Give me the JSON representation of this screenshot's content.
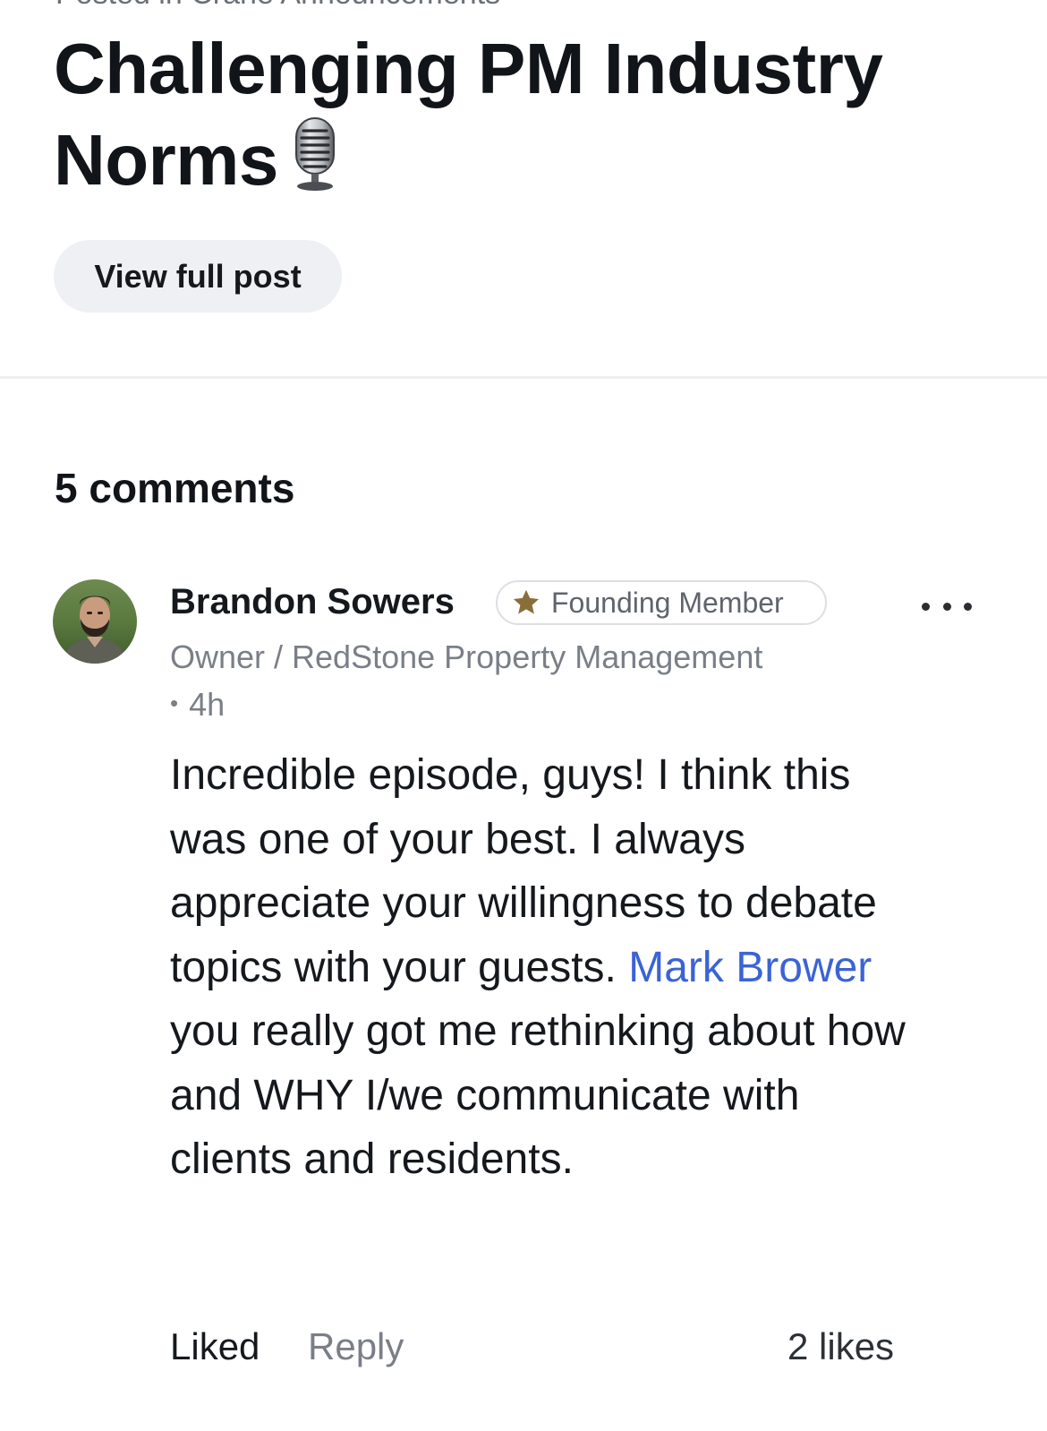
{
  "post": {
    "posted_in": "Posted in Crane Announcements",
    "title": "Challenging PM Industry Norms",
    "title_icon": "microphone-icon",
    "view_full_post_label": "View full post"
  },
  "comments_section": {
    "count_label": "5 comments"
  },
  "comment": {
    "author": {
      "name": "Brandon Sowers",
      "badge_icon": "star-icon",
      "badge_label": "Founding Member",
      "headline": "Owner / RedStone Property Management",
      "avatar_icon": "avatar-photo"
    },
    "time_separator": "•",
    "time": "4h",
    "body": {
      "text_before_mention": "Incredible episode, guys! I think this was one of your best. I always appreciate your willingness to debate topics with your guests. ",
      "mention": "Mark Brower",
      "text_after_mention": " you really got me rethinking about how and WHY I/we communicate with clients and residents."
    },
    "actions": {
      "liked_label": "Liked",
      "reply_label": "Reply",
      "likes_count_label": "2 likes"
    },
    "more_options_icon": "more-options-icon"
  },
  "colors": {
    "text_primary": "#15181c",
    "text_secondary": "#7a7f87",
    "mention_link": "#3b63d4",
    "button_background": "#eef0f3",
    "badge_star": "#8a6e3a",
    "divider": "#eceef1"
  }
}
